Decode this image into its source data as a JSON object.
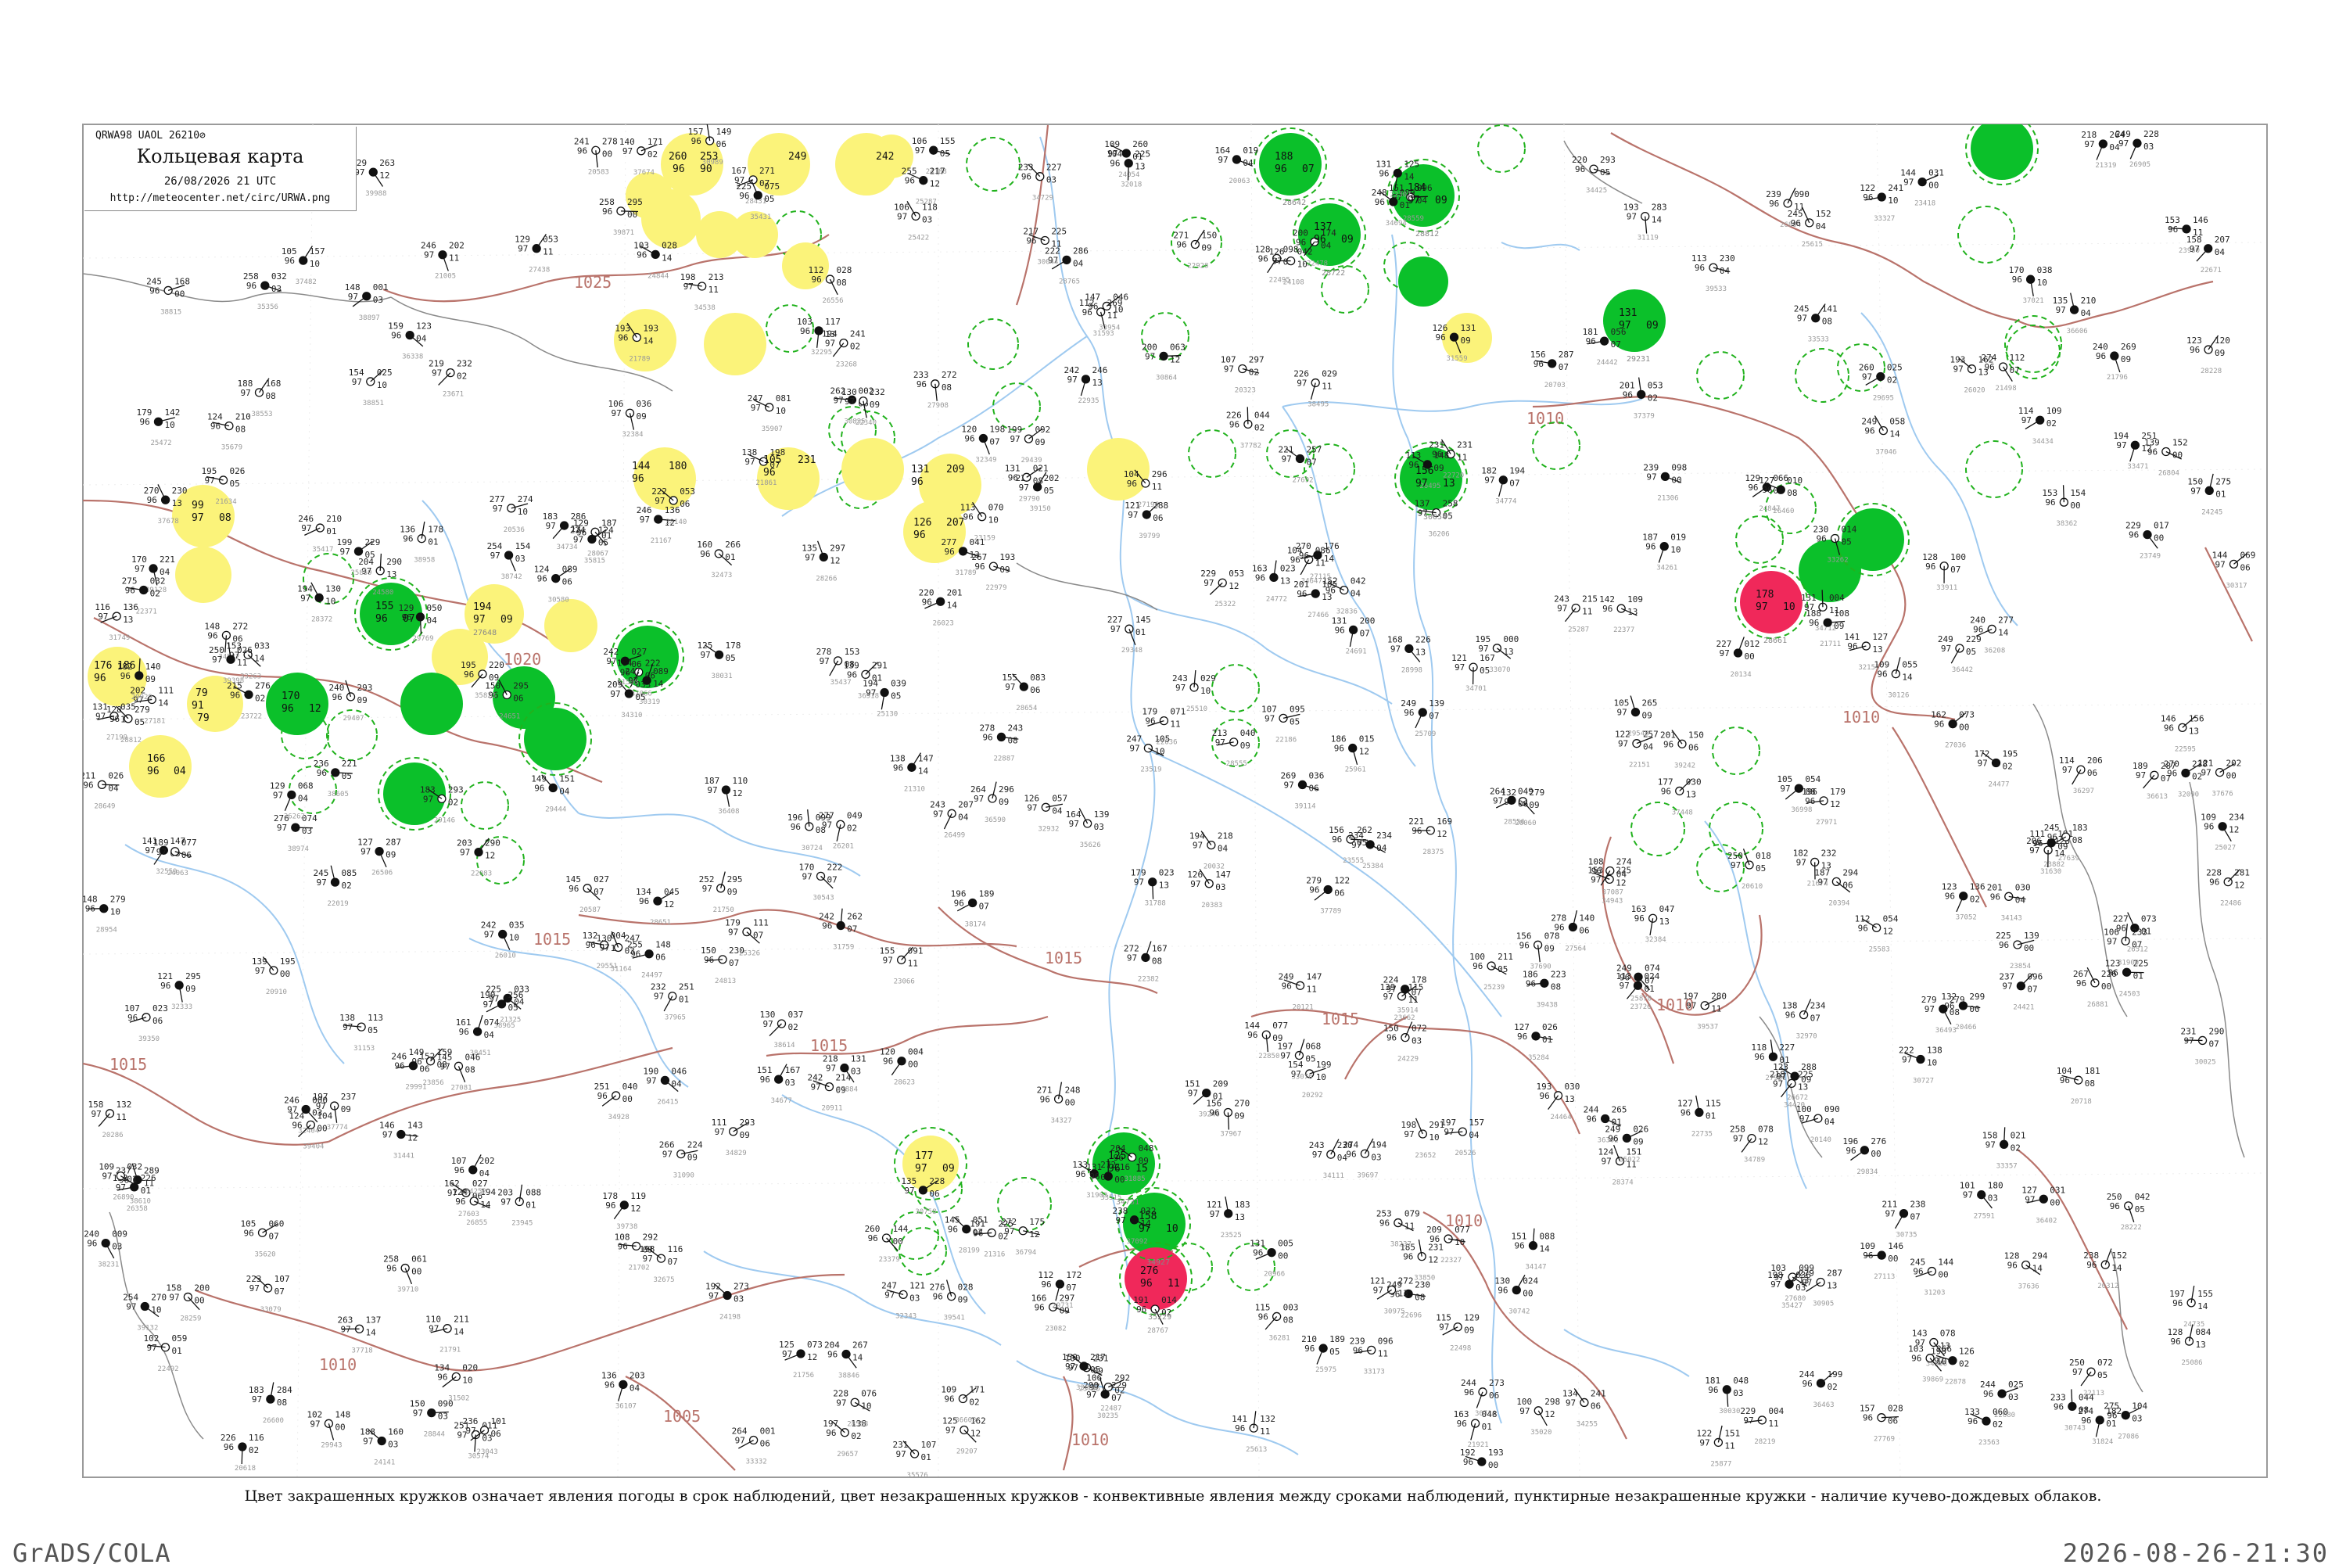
{
  "title_box": {
    "code_line": "QRWA98  UAOL  26210⊘",
    "title": "Кольцевая карта",
    "date_line": "26/08/2026 21 UTC",
    "url": "http://meteocenter.net/circ/URWA.png"
  },
  "caption": "Цвет закрашенных кружков означает явления погоды в срок наблюдений, цвет незакрашенных кружков - конвективные явления между сроками наблюдений, пунктирные незакрашенные кружки - наличие кучево-дождевых облаков.",
  "footer": {
    "left": "GrADS/COLA",
    "right": "2026-08-26-21:30"
  },
  "colors": {
    "green": "#0bc02a",
    "yellow": "#fbf37a",
    "red": "#f0285a",
    "dashed_ring": "#21b21d",
    "isobar": "#b9736b",
    "river": "#9fcaf0",
    "road": "#8a8a8a"
  },
  "isobar_labels": [
    "1025",
    "1020",
    "1015",
    "1015",
    "1015",
    "1015",
    "1015",
    "1010",
    "1010",
    "1010",
    "1010",
    "1010",
    "1010",
    "1005"
  ],
  "stations": [
    {
      "id": "27648",
      "t": "194",
      "p": "97",
      "td": "09",
      "kind": "plain"
    },
    {
      "id": "27451",
      "t": "260",
      "p": "96",
      "td": "90",
      "kind": "yellow"
    },
    {
      "id": "27553",
      "t": "253",
      "p": "96",
      "td": "10",
      "kind": "yellow"
    },
    {
      "id": "27631",
      "t": "249",
      "p": "96",
      "td": "10",
      "kind": "yellow"
    },
    {
      "id": "27726",
      "t": "242",
      "p": "97",
      "td": "12",
      "kind": "yellow"
    },
    {
      "id": "28642",
      "t": "188",
      "p": "96",
      "td": "07",
      "kind": "green"
    },
    {
      "id": "28722",
      "t": "137",
      "p": "96",
      "td": "09",
      "kind": "green"
    },
    {
      "id": "28812",
      "t": "184",
      "p": "97",
      "td": "09",
      "kind": "green"
    },
    {
      "id": "29231",
      "t": "131",
      "p": "97",
      "td": "09",
      "kind": "green"
    },
    {
      "id": "30054",
      "t": "156",
      "p": "97",
      "td": "13",
      "kind": "green"
    },
    {
      "id": "28661",
      "t": "178",
      "p": "97",
      "td": "10",
      "kind": "red"
    },
    {
      "id": "34731",
      "t": "125",
      "p": "96",
      "td": "15",
      "kind": "green"
    },
    {
      "id": "34927",
      "t": "158",
      "p": "97",
      "td": "10",
      "kind": "green"
    },
    {
      "id": "33041",
      "t": "155",
      "p": "96",
      "td": "07",
      "kind": "green"
    },
    {
      "id": "33377",
      "t": "177",
      "p": "97",
      "td": "09",
      "kind": "yellow"
    },
    {
      "id": "35229",
      "t": "276",
      "p": "96",
      "td": "11",
      "kind": "red"
    },
    {
      "id": "34163",
      "t": "170",
      "p": "96",
      "td": "12",
      "kind": "green"
    },
    {
      "id": "26063",
      "t": "99",
      "p": "97",
      "td": "08",
      "kind": "yellow"
    },
    {
      "id": "26242",
      "t": "79",
      "p": "91",
      "td": "79",
      "kind": "yellow"
    },
    {
      "id": "26258",
      "t": "176",
      "p": "96",
      "td": "186",
      "kind": "yellow"
    },
    {
      "id": "27196",
      "t": "144",
      "p": "96",
      "td": "180",
      "kind": "yellow"
    },
    {
      "id": "27518",
      "t": "166",
      "p": "96",
      "td": "04",
      "kind": "yellow"
    },
    {
      "id": "27785",
      "t": "105",
      "p": "96",
      "td": "231",
      "kind": "yellow"
    },
    {
      "id": "27857",
      "t": "131",
      "p": "96",
      "td": "209",
      "kind": "yellow"
    },
    {
      "id": "27919",
      "t": "126",
      "p": "96",
      "td": "207",
      "kind": "yellow"
    }
  ]
}
